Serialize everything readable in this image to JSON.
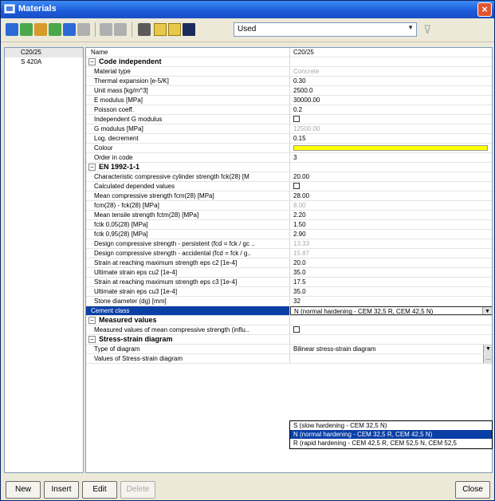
{
  "window": {
    "title": "Materials",
    "close": "×"
  },
  "toolbar": {
    "filter_value": "Used",
    "filter_icon": "funnel-icon"
  },
  "materials": [
    "C20/25",
    "S 420A"
  ],
  "grid": [
    {
      "type": "row",
      "name": "Name",
      "value": "C20/25"
    },
    {
      "type": "group",
      "name": "Code independent",
      "expander": "−"
    },
    {
      "type": "sub",
      "name": "Material type",
      "value": "Concrete",
      "grey": true
    },
    {
      "type": "sub",
      "name": "Thermal expansion [e-5/K]",
      "value": "0.30"
    },
    {
      "type": "sub",
      "name": "Unit mass [kg/m^3]",
      "value": "2500.0"
    },
    {
      "type": "sub",
      "name": "E modulus [MPa]",
      "value": "30000.00"
    },
    {
      "type": "sub",
      "name": "Poisson coeff.",
      "value": "0.2"
    },
    {
      "type": "sub",
      "name": "Independent G modulus",
      "value": "",
      "checkbox": true
    },
    {
      "type": "sub",
      "name": "G modulus [MPa]",
      "value": "12500.00",
      "grey": true
    },
    {
      "type": "sub",
      "name": "Log. decrement",
      "value": "0.15"
    },
    {
      "type": "sub",
      "name": "Colour",
      "value": "",
      "color": true
    },
    {
      "type": "sub",
      "name": "Order in code",
      "value": "3"
    },
    {
      "type": "group",
      "name": "EN 1992-1-1",
      "expander": "−"
    },
    {
      "type": "sub",
      "name": "Characteristic compressive cylinder strength fck(28) [M",
      "value": "20.00"
    },
    {
      "type": "sub",
      "name": "Calculated depended values",
      "value": "",
      "checkbox": true
    },
    {
      "type": "sub",
      "name": "Mean compressive strength fcm(28) [MPa]",
      "value": "28.00"
    },
    {
      "type": "sub",
      "name": "fcm(28) - fck(28) [MPa]",
      "value": "8.00",
      "grey": true
    },
    {
      "type": "sub",
      "name": "Mean tensile strength fctm(28) [MPa]",
      "value": "2.20"
    },
    {
      "type": "sub",
      "name": "fctk 0,05(28) [MPa]",
      "value": "1.50"
    },
    {
      "type": "sub",
      "name": "fctk 0,95(28) [MPa]",
      "value": "2.90"
    },
    {
      "type": "sub",
      "name": "Design compressive strength - persistent (fcd = fck / gc ..",
      "value": "13.33",
      "grey": true
    },
    {
      "type": "sub",
      "name": "Design compressive strength - accidental (fcd = fck / g..",
      "value": "15.87",
      "grey": true
    },
    {
      "type": "sub",
      "name": "Strain at reaching maximum strength eps c2 [1e-4]",
      "value": "20.0"
    },
    {
      "type": "sub",
      "name": "Ultimate strain eps cu2 [1e-4]",
      "value": "35.0"
    },
    {
      "type": "sub",
      "name": "Strain at reaching maximum strength eps c3 [1e-4]",
      "value": "17.5"
    },
    {
      "type": "sub",
      "name": "Ultimate strain eps cu3 [1e-4]",
      "value": "35.0"
    },
    {
      "type": "sub",
      "name": "Stone diameter (dg) [mm]",
      "value": "32"
    },
    {
      "type": "active",
      "name": "Cement class",
      "value": "N (normal hardening - CEM 32,5 R, CEM 42,5 N)"
    },
    {
      "type": "group",
      "name": "Measured values",
      "expander": "−"
    },
    {
      "type": "sub",
      "name": "Measured values of mean compressive strength (influ..",
      "value": "",
      "checkbox": true
    },
    {
      "type": "group",
      "name": "Stress-strain diagram",
      "expander": "−"
    },
    {
      "type": "sub",
      "name": "Type of diagram",
      "value": "Bilinear stress-strain diagram",
      "dropdown": true
    },
    {
      "type": "sub",
      "name": "Values of Stress-strain diagram",
      "value": "",
      "ellipsis": true
    }
  ],
  "cement_options": [
    "S (slow hardening - CEM 32,5 N)",
    "N (normal hardening - CEM 32,5 R, CEM 42,5 N)",
    "R (rapid hardening - CEM 42,5 R, CEM 52,5 N, CEM 52,5"
  ],
  "cement_selected": 1,
  "buttons": {
    "new": "New",
    "insert": "Insert",
    "edit": "Edit",
    "delete": "Delete",
    "close": "Close"
  }
}
